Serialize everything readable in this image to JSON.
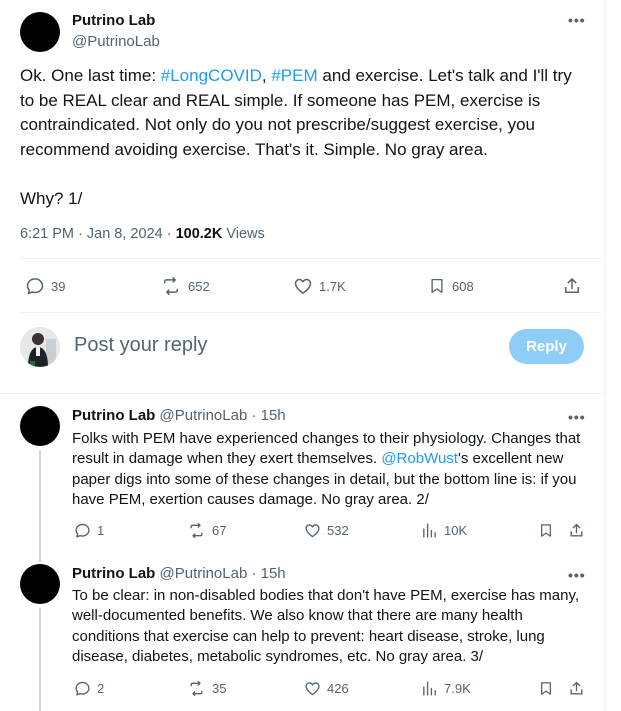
{
  "main_tweet": {
    "name": "Putrino Lab",
    "handle": "@PutrinoLab",
    "text_lead": "Ok. One last time: ",
    "hashtag1": "#LongCOVID",
    "comma": ", ",
    "hashtag2": "#PEM",
    "text_rest": " and exercise. Let's talk and I'll try to be REAL clear and REAL simple. If someone has PEM, exercise is contraindicated. Not only do you not prescribe/suggest exercise, you recommend avoiding exercise. That's it. Simple. No gray area.",
    "text_why": "Why? 1/",
    "timestamp": "6:21 PM · Jan 8, 2024",
    "dot": " · ",
    "views_count": "100.2K",
    "views_label": " Views",
    "stats": {
      "replies": "39",
      "reposts": "652",
      "likes": "1.7K",
      "bookmarks": "608"
    }
  },
  "composer": {
    "placeholder": "Post your reply",
    "reply_label": "Reply"
  },
  "replies": [
    {
      "name": "Putrino Lab",
      "handle": "@PutrinoLab",
      "time": " · 15h",
      "text_a": "Folks with PEM have experienced changes to their physiology. Changes that result in damage when they exert themselves. ",
      "mention": "@RobWust",
      "text_b": "'s excellent new paper digs into some of these changes in detail, but the bottom line is: if you have PEM, exertion causes damage. No gray area. 2/",
      "stats": {
        "replies": "1",
        "reposts": "67",
        "likes": "532",
        "views": "10K"
      }
    },
    {
      "name": "Putrino Lab",
      "handle": "@PutrinoLab",
      "time": " · 15h",
      "text_a": "To be clear: in non-disabled bodies that don't have PEM, exercise has many, well-documented benefits. We also know that there are many health conditions that exercise can help to prevent: heart disease, stroke, lung disease, diabetes, metabolic syndromes, etc. No gray area. 3/",
      "stats": {
        "replies": "2",
        "reposts": "35",
        "likes": "426",
        "views": "7.9K"
      }
    }
  ],
  "colors": {
    "link": "#1d9bf0",
    "secondary_text": "#536471",
    "reply_button_bg": "#8ecdf8",
    "divider": "#eff3f4"
  },
  "icons": [
    "more-icon",
    "reply-icon",
    "repost-icon",
    "like-icon",
    "bookmark-icon",
    "share-icon",
    "views-icon"
  ]
}
